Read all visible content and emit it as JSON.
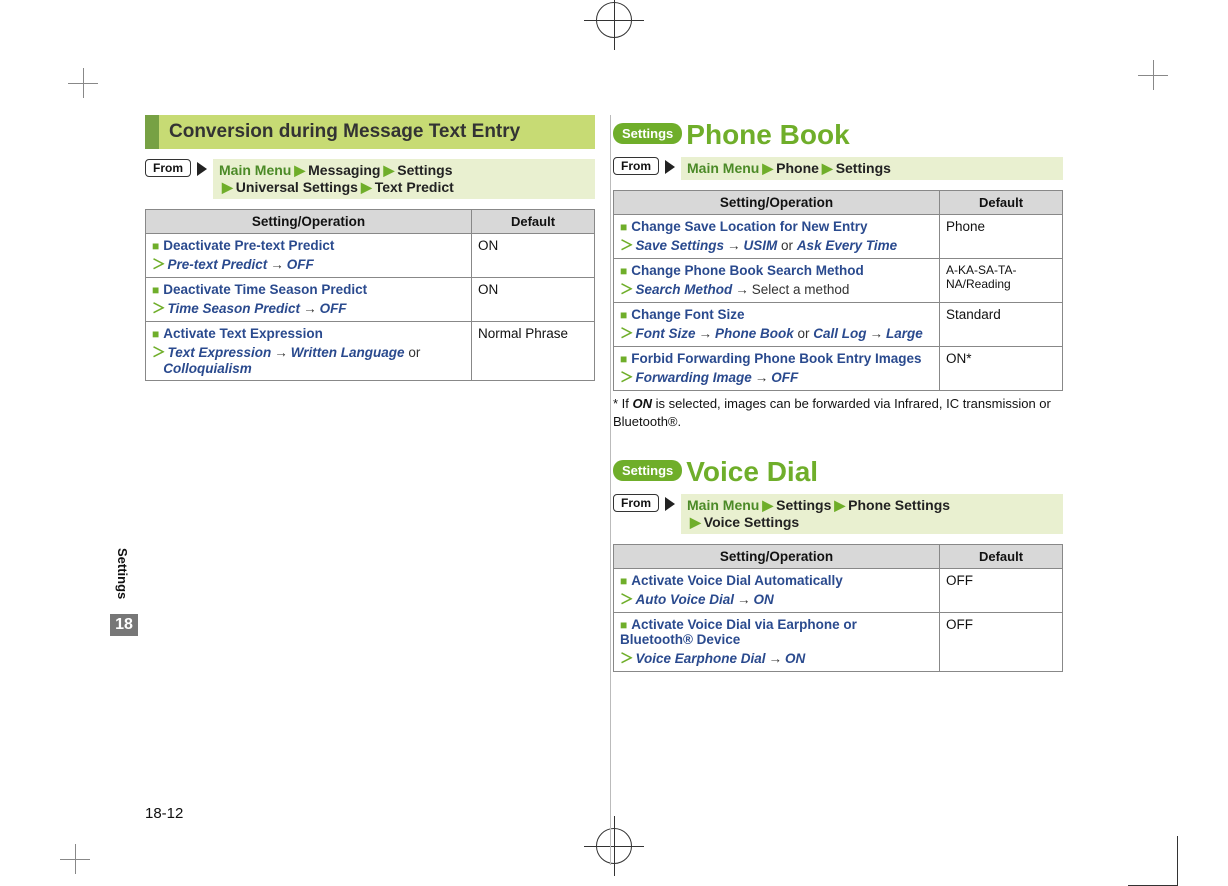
{
  "side": {
    "label": "Settings",
    "chapter": "18"
  },
  "page_number": "18-12",
  "left": {
    "banner": "Conversion during Message Text Entry",
    "from": {
      "badge": "From",
      "path": [
        "Main Menu",
        "Messaging",
        "Settings",
        "Universal Settings",
        "Text Predict"
      ]
    },
    "table": {
      "headers": [
        "Setting/Operation",
        "Default"
      ],
      "rows": [
        {
          "title": "Deactivate Pre-text Predict",
          "path_parts": [
            "Pre-text Predict",
            "→",
            "OFF"
          ],
          "default": "ON"
        },
        {
          "title": "Deactivate Time Season Predict",
          "path_parts": [
            "Time Season Predict",
            "→",
            "OFF"
          ],
          "default": "ON"
        },
        {
          "title": "Activate Text Expression",
          "path_parts": [
            "Text Expression",
            "→",
            "Written Language",
            " or ",
            "Colloquialism"
          ],
          "default": "Normal Phrase"
        }
      ]
    }
  },
  "right": {
    "sections": [
      {
        "badge": "Settings",
        "title": "Phone Book",
        "from": {
          "badge": "From",
          "path": [
            "Main Menu",
            "Phone",
            "Settings"
          ]
        },
        "table": {
          "headers": [
            "Setting/Operation",
            "Default"
          ],
          "rows": [
            {
              "title": "Change Save Location for New Entry",
              "path_parts": [
                "Save Settings",
                "→",
                "USIM",
                " or ",
                "Ask Every Time"
              ],
              "default": "Phone"
            },
            {
              "title": "Change Phone Book Search Method",
              "path_parts": [
                "Search Method",
                "→",
                "Select a method"
              ],
              "default": "A-KA-SA-TA-NA/Reading"
            },
            {
              "title": "Change Font Size",
              "path_parts": [
                "Font Size",
                "→",
                "Phone Book",
                " or ",
                "Call Log",
                "→",
                "Large"
              ],
              "default": "Standard"
            },
            {
              "title": "Forbid Forwarding Phone Book Entry Images",
              "path_parts": [
                "Forwarding Image",
                "→",
                "OFF"
              ],
              "default": "ON*"
            }
          ]
        },
        "note_prefix": "* If ",
        "note_bold": "ON",
        "note_suffix": " is selected, images can be forwarded via Infrared, IC transmission or Bluetooth®."
      },
      {
        "badge": "Settings",
        "title": "Voice Dial",
        "from": {
          "badge": "From",
          "path": [
            "Main Menu",
            "Settings",
            "Phone Settings",
            "Voice Settings"
          ]
        },
        "table": {
          "headers": [
            "Setting/Operation",
            "Default"
          ],
          "rows": [
            {
              "title": "Activate Voice Dial Automatically",
              "path_parts": [
                "Auto Voice Dial",
                "→",
                "ON"
              ],
              "default": "OFF"
            },
            {
              "title": "Activate Voice Dial via Earphone or Bluetooth® Device",
              "path_parts": [
                "Voice Earphone Dial",
                "→",
                "ON"
              ],
              "default": "OFF"
            }
          ]
        }
      }
    ]
  }
}
